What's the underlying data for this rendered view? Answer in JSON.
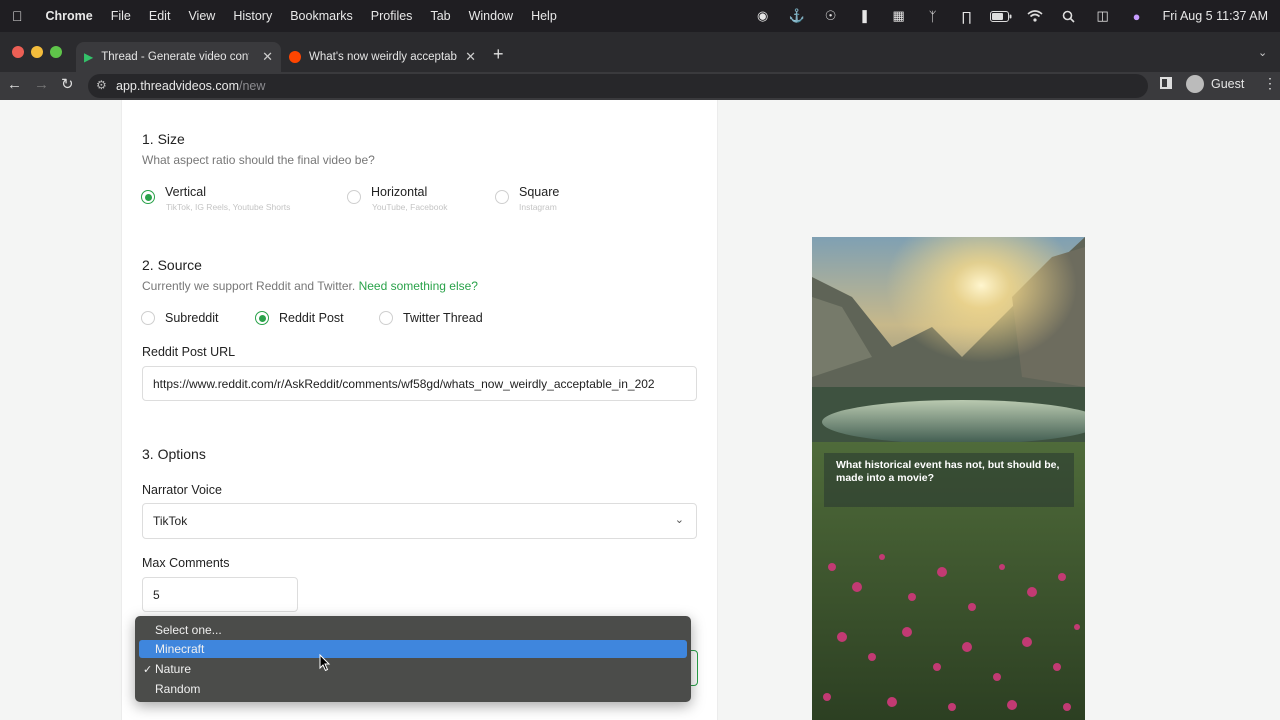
{
  "menubar": {
    "apple": "",
    "app": "Chrome",
    "items": [
      "File",
      "Edit",
      "View",
      "History",
      "Bookmarks",
      "Profiles",
      "Tab",
      "Window",
      "Help"
    ],
    "clock": "Fri Aug 5  11:37 AM"
  },
  "tabs": [
    {
      "title": "Thread - Generate video conte",
      "icon": "play-icon",
      "active": true
    },
    {
      "title": "What's now weirdly acceptable",
      "icon": "reddit-icon",
      "active": false
    }
  ],
  "address": {
    "host": "app.threadvideos.com",
    "path": "/new",
    "profile": "Guest"
  },
  "form": {
    "size": {
      "title": "1. Size",
      "subtitle": "What aspect ratio should the final video be?",
      "options": [
        {
          "label": "Vertical",
          "hint": "TikTok, IG Reels, Youtube Shorts",
          "selected": true
        },
        {
          "label": "Horizontal",
          "hint": "YouTube, Facebook",
          "selected": false
        },
        {
          "label": "Square",
          "hint": "Instagram",
          "selected": false
        }
      ]
    },
    "source": {
      "title": "2. Source",
      "subtitle": "Currently we support Reddit and Twitter.",
      "link": "Need something else?",
      "options": [
        {
          "label": "Subreddit",
          "selected": false
        },
        {
          "label": "Reddit Post",
          "selected": true
        },
        {
          "label": "Twitter Thread",
          "selected": false
        }
      ],
      "url_label": "Reddit Post URL",
      "url_value": "https://www.reddit.com/r/AskReddit/comments/wf58gd/whats_now_weirdly_acceptable_in_202"
    },
    "options": {
      "title": "3. Options",
      "voice_label": "Narrator Voice",
      "voice_value": "TikTok",
      "max_label": "Max Comments",
      "max_value": "5"
    },
    "background_dropdown": {
      "options": [
        "Select one...",
        "Minecraft",
        "Nature",
        "Random"
      ],
      "highlighted": "Minecraft",
      "checked": "Nature"
    }
  },
  "preview": {
    "caption": "What historical event has not, but should be, made into a movie?"
  },
  "colors": {
    "accent": "#2aa24a",
    "highlight": "#3f86dd"
  }
}
